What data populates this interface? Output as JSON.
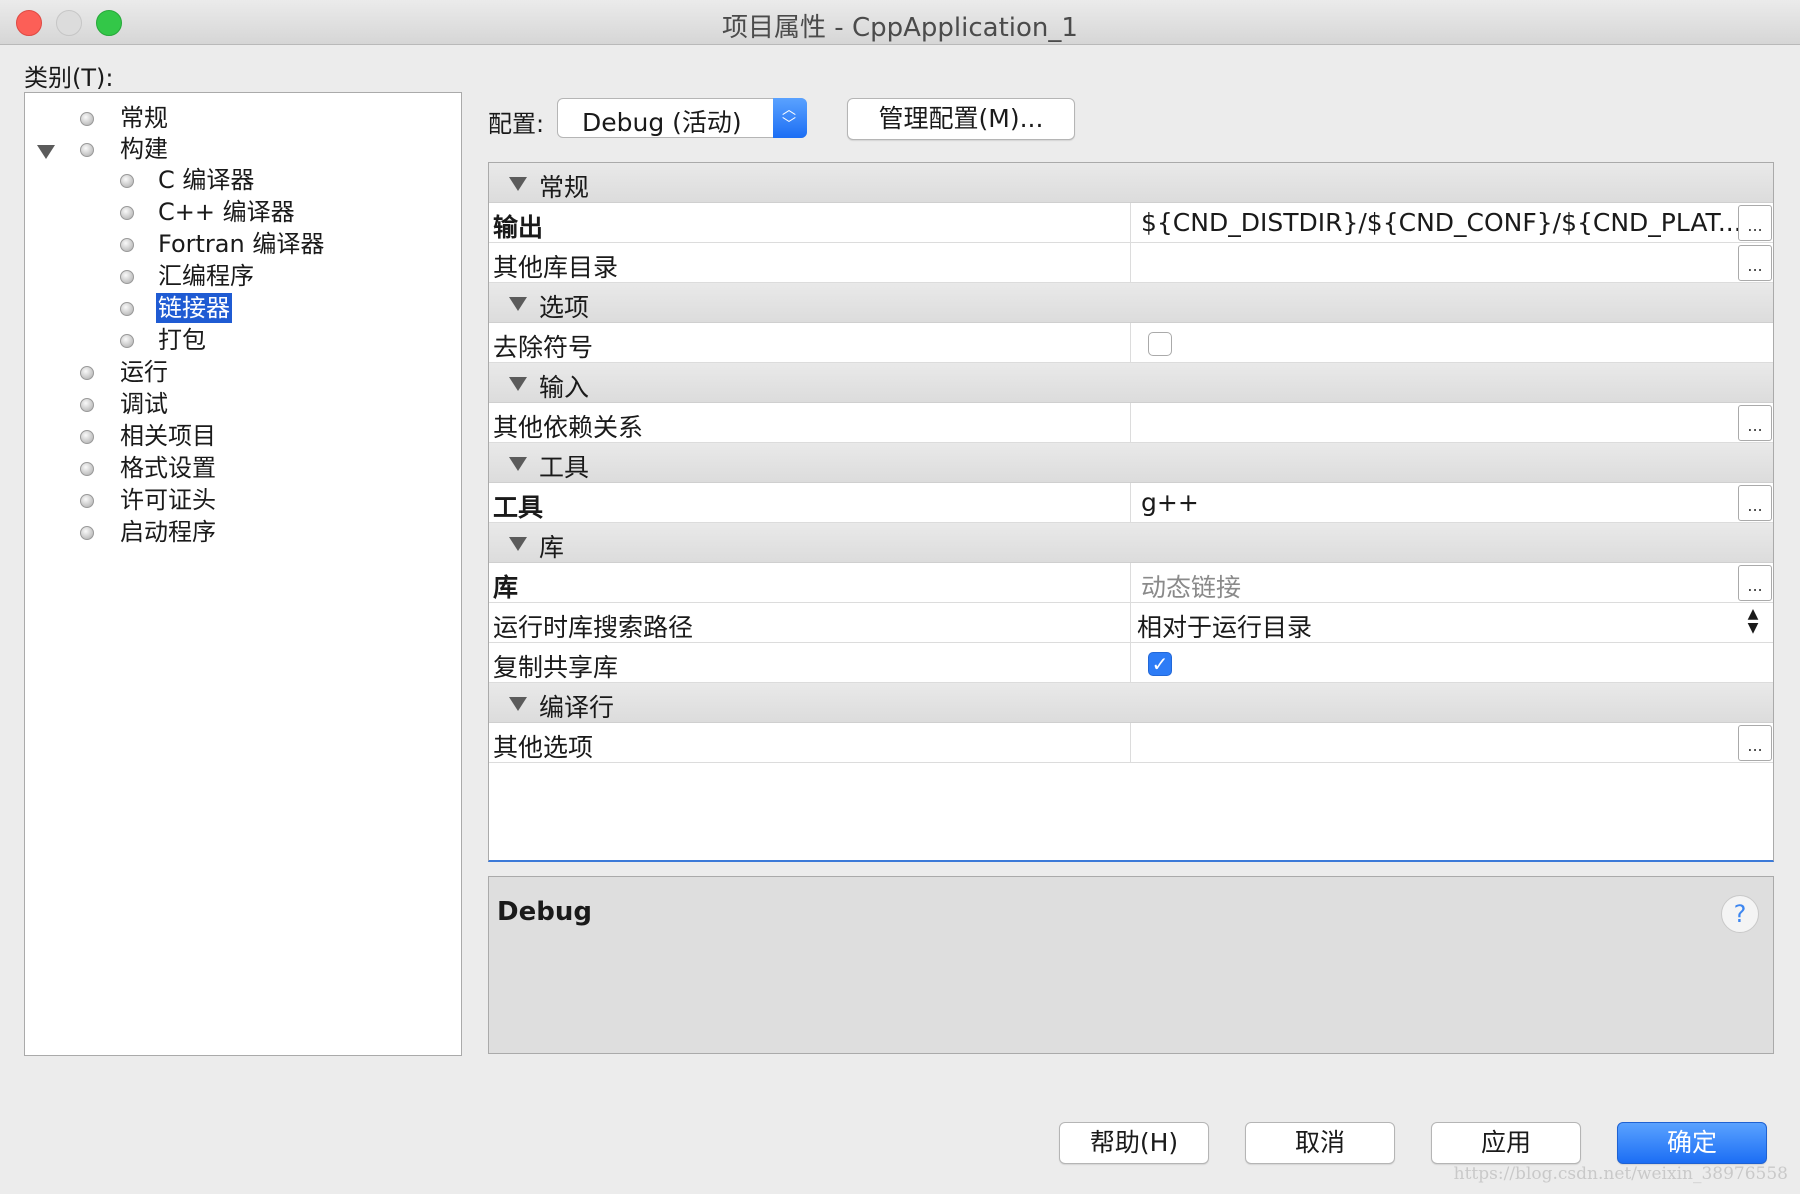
{
  "window": {
    "title": "项目属性 - CppApplication_1"
  },
  "categories": {
    "label": "类别(T):",
    "items": [
      {
        "label": "常规"
      },
      {
        "label": "构建"
      },
      {
        "label": "C 编译器"
      },
      {
        "label": "C++ 编译器"
      },
      {
        "label": "Fortran 编译器"
      },
      {
        "label": "汇编程序"
      },
      {
        "label": "链接器"
      },
      {
        "label": "打包"
      },
      {
        "label": "运行"
      },
      {
        "label": "调试"
      },
      {
        "label": "相关项目"
      },
      {
        "label": "格式设置"
      },
      {
        "label": "许可证头"
      },
      {
        "label": "启动程序"
      }
    ]
  },
  "config": {
    "label": "配置:",
    "selected": "Debug (活动)",
    "manage_button": "管理配置(M)..."
  },
  "properties": {
    "sections": [
      {
        "label": "常规"
      },
      {
        "label": "选项"
      },
      {
        "label": "输入"
      },
      {
        "label": "工具"
      },
      {
        "label": "库"
      },
      {
        "label": "编译行"
      }
    ],
    "rows": [
      {
        "name": "输出",
        "value": "${CND_DISTDIR}/${CND_CONF}/${CND_PLAT..."
      },
      {
        "name": "其他库目录",
        "value": ""
      },
      {
        "name": "去除符号",
        "value": ""
      },
      {
        "name": "其他依赖关系",
        "value": ""
      },
      {
        "name": "工具",
        "value": "g++"
      },
      {
        "name": "库",
        "value": "动态链接"
      },
      {
        "name": "运行时库搜索路径",
        "value": "相对于运行目录"
      },
      {
        "name": "复制共享库",
        "value": ""
      },
      {
        "name": "其他选项",
        "value": ""
      }
    ],
    "ellipsis_label": "..."
  },
  "description": {
    "name": "Debug",
    "help_glyph": "?"
  },
  "buttons": {
    "help": "帮助(H)",
    "cancel": "取消",
    "apply": "应用",
    "ok": "确定"
  },
  "watermark": "https://blog.csdn.net/weixin_38976558",
  "colors": {
    "accent": "#1c6ef4",
    "selection": "#1f5bd3"
  }
}
